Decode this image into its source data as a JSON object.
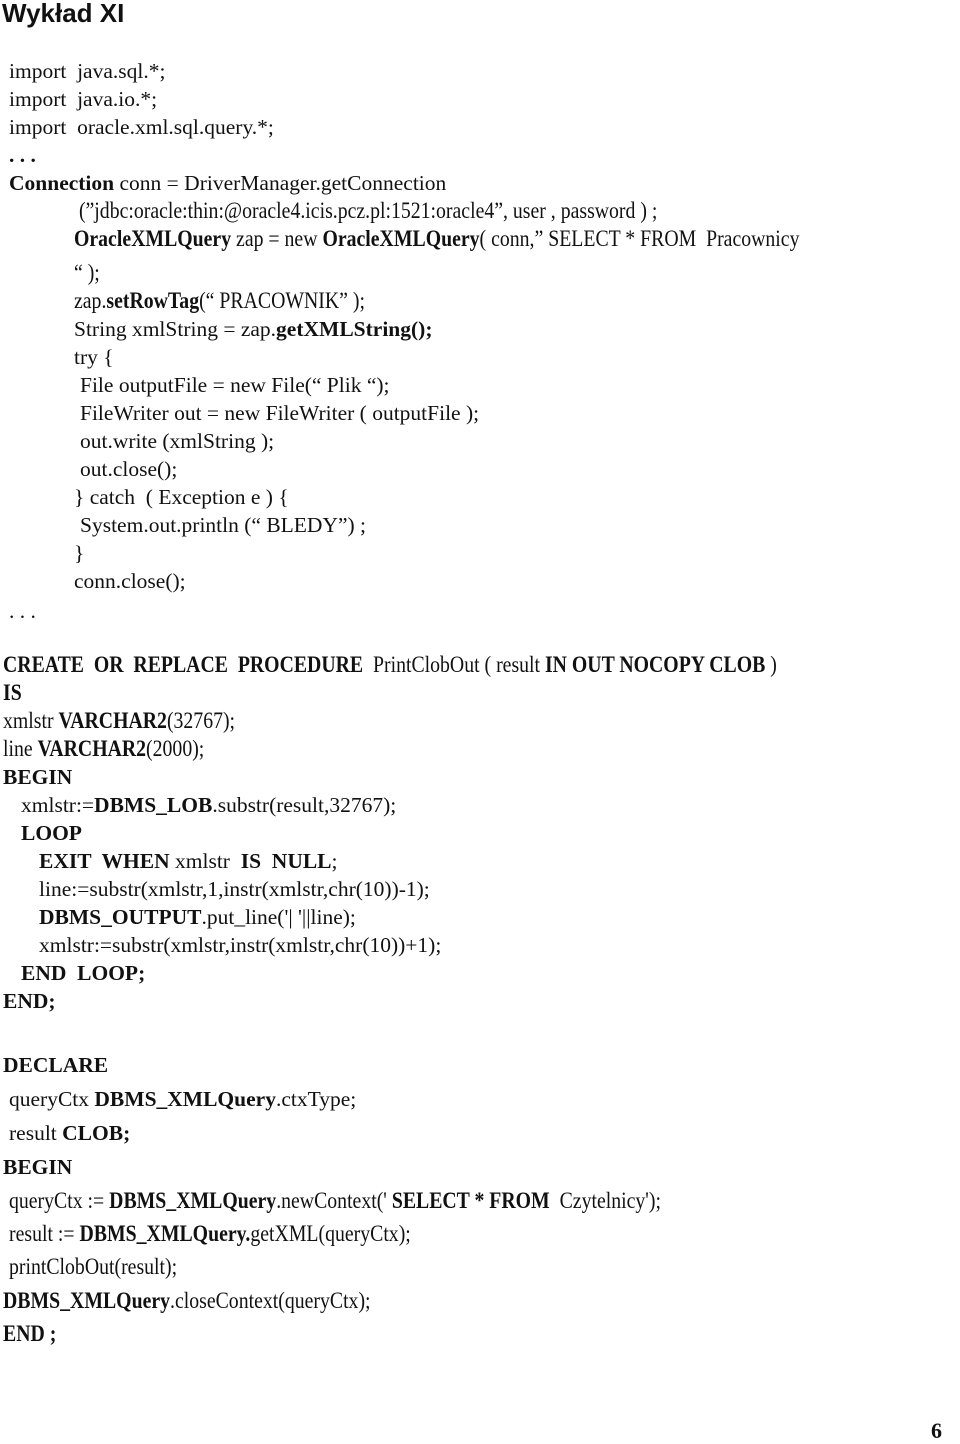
{
  "document": {
    "title": "Wykład XI",
    "page_number": "6"
  },
  "java_block": [
    {
      "indent": 9,
      "segs": [
        {
          "t": "import  java.sql.*;",
          "b": false
        }
      ]
    },
    {
      "indent": 9,
      "segs": [
        {
          "t": "import  java.io.*;",
          "b": false
        }
      ]
    },
    {
      "indent": 9,
      "segs": [
        {
          "t": "import  oracle.xml.sql.query.*;",
          "b": false
        }
      ]
    },
    {
      "indent": 9,
      "segs": [
        {
          "t": ". . .",
          "b": true
        }
      ]
    },
    {
      "indent": 9,
      "segs": [
        {
          "t": "Connection",
          "b": true
        },
        {
          "t": " conn = DriverManager.getConnection",
          "b": false
        }
      ]
    },
    {
      "indent": 74,
      "segs": [
        {
          "t": " (”jdbc:oracle:thin:@oracle4.icis.pcz.pl:1521:oracle4”, user , password ) ;",
          "b": false
        }
      ]
    },
    {
      "indent": 74,
      "segs": [
        {
          "t": "OracleXMLQuery",
          "b": true
        },
        {
          "t": " zap = new ",
          "b": false
        },
        {
          "t": "OracleXMLQuery",
          "b": true
        },
        {
          "t": "( conn,” SELECT * FROM  Pracownicy",
          "b": false
        }
      ]
    },
    {
      "indent": 74,
      "segs": [
        {
          "t": "“ );",
          "b": false
        }
      ]
    },
    {
      "indent": 74,
      "segs": [
        {
          "t": "zap.",
          "b": false
        },
        {
          "t": "setRowTag",
          "b": true
        },
        {
          "t": "(“ PRACOWNIK” );",
          "b": false
        }
      ]
    },
    {
      "indent": 74,
      "segs": [
        {
          "t": "String xmlString = zap.",
          "b": false
        },
        {
          "t": "getXMLString();",
          "b": true
        }
      ]
    },
    {
      "indent": 74,
      "segs": [
        {
          "t": "try {",
          "b": false
        }
      ]
    },
    {
      "indent": 80,
      "segs": [
        {
          "t": "File outputFile = new File(“ Plik “);",
          "b": false
        }
      ]
    },
    {
      "indent": 80,
      "segs": [
        {
          "t": "FileWriter out = new FileWriter ( outputFile );",
          "b": false
        }
      ]
    },
    {
      "indent": 80,
      "segs": [
        {
          "t": "out.write (xmlString );",
          "b": false
        }
      ]
    },
    {
      "indent": 80,
      "segs": [
        {
          "t": "out.close();",
          "b": false
        }
      ]
    },
    {
      "indent": 74,
      "segs": [
        {
          "t": "} catch  ( Exception e ) {",
          "b": false
        }
      ]
    },
    {
      "indent": 80,
      "segs": [
        {
          "t": "System.out.println (“ BLEDY”) ;",
          "b": false
        }
      ]
    },
    {
      "indent": 74,
      "segs": [
        {
          "t": "}",
          "b": false
        }
      ]
    },
    {
      "indent": 74,
      "segs": [
        {
          "t": "conn.close();",
          "b": false
        }
      ]
    },
    {
      "indent": 9,
      "segs": [
        {
          "t": ". . .",
          "b": false
        }
      ]
    }
  ],
  "plsql_procedure_block": [
    {
      "indent": 3,
      "segs": [
        {
          "t": "CREATE  OR  REPLACE  PROCEDURE",
          "b": true
        },
        {
          "t": "  PrintClobOut ( result ",
          "b": false
        },
        {
          "t": "IN OUT NOCOPY CLOB",
          "b": true
        },
        {
          "t": " )",
          "b": false
        }
      ]
    },
    {
      "indent": 3,
      "segs": [
        {
          "t": "IS",
          "b": true
        }
      ]
    },
    {
      "indent": 3,
      "segs": [
        {
          "t": "xmlstr ",
          "b": false
        },
        {
          "t": "VARCHAR2",
          "b": true
        },
        {
          "t": "(32767);",
          "b": false
        }
      ]
    },
    {
      "indent": 3,
      "segs": [
        {
          "t": "line ",
          "b": false
        },
        {
          "t": "VARCHAR2",
          "b": true
        },
        {
          "t": "(2000);",
          "b": false
        }
      ]
    },
    {
      "indent": 3,
      "segs": [
        {
          "t": "BEGIN",
          "b": true
        }
      ]
    },
    {
      "indent": 21,
      "segs": [
        {
          "t": "xmlstr:=",
          "b": false
        },
        {
          "t": "DBMS_LOB",
          "b": true
        },
        {
          "t": ".substr(result,32767);",
          "b": false
        }
      ]
    },
    {
      "indent": 21,
      "segs": [
        {
          "t": "LOOP",
          "b": true
        }
      ]
    },
    {
      "indent": 39,
      "segs": [
        {
          "t": "EXIT  WHEN",
          "b": true
        },
        {
          "t": " xmlstr  ",
          "b": false
        },
        {
          "t": "IS  NULL",
          "b": true
        },
        {
          "t": ";",
          "b": false
        }
      ]
    },
    {
      "indent": 39,
      "segs": [
        {
          "t": "line:=substr(xmlstr,1,instr(xmlstr,chr(10))-1);",
          "b": false
        }
      ]
    },
    {
      "indent": 39,
      "segs": [
        {
          "t": "DBMS_OUTPUT",
          "b": true
        },
        {
          "t": ".put_line('| '||line);",
          "b": false
        }
      ]
    },
    {
      "indent": 39,
      "segs": [
        {
          "t": "xmlstr:=substr(xmlstr,instr(xmlstr,chr(10))+1);",
          "b": false
        }
      ]
    },
    {
      "indent": 21,
      "segs": [
        {
          "t": "END  LOOP;",
          "b": true
        }
      ]
    },
    {
      "indent": 3,
      "segs": [
        {
          "t": "END;",
          "b": true
        }
      ]
    }
  ],
  "plsql_anonymous_block": [
    {
      "indent": 3,
      "segs": [
        {
          "t": "DECLARE",
          "b": true
        }
      ]
    },
    {
      "indent": 9,
      "segs": [
        {
          "t": "queryCtx ",
          "b": false
        },
        {
          "t": "DBMS_XMLQuery",
          "b": true
        },
        {
          "t": ".ctxType;",
          "b": false
        }
      ]
    },
    {
      "indent": 9,
      "segs": [
        {
          "t": "result ",
          "b": false
        },
        {
          "t": "CLOB;",
          "b": true
        }
      ]
    },
    {
      "indent": 3,
      "segs": [
        {
          "t": "BEGIN",
          "b": true
        }
      ]
    },
    {
      "indent": 9,
      "segs": [
        {
          "t": "queryCtx := ",
          "b": false
        },
        {
          "t": "DBMS_XMLQuery",
          "b": true
        },
        {
          "t": ".newContext(' ",
          "b": false
        },
        {
          "t": "SELECT * FROM",
          "b": true
        },
        {
          "t": "  Czytelnicy');",
          "b": false
        }
      ]
    },
    {
      "indent": 9,
      "segs": [
        {
          "t": "result := ",
          "b": false
        },
        {
          "t": "DBMS_XMLQuery.",
          "b": true
        },
        {
          "t": "getXML(queryCtx);",
          "b": false
        }
      ]
    },
    {
      "indent": 9,
      "segs": [
        {
          "t": "printClobOut(result);",
          "b": false
        }
      ]
    },
    {
      "indent": 3,
      "segs": [
        {
          "t": "DBMS_XMLQuery",
          "b": true
        },
        {
          "t": ".closeContext(queryCtx);",
          "b": false
        }
      ]
    },
    {
      "indent": 3,
      "segs": [
        {
          "t": "END ;",
          "b": true
        }
      ]
    }
  ]
}
